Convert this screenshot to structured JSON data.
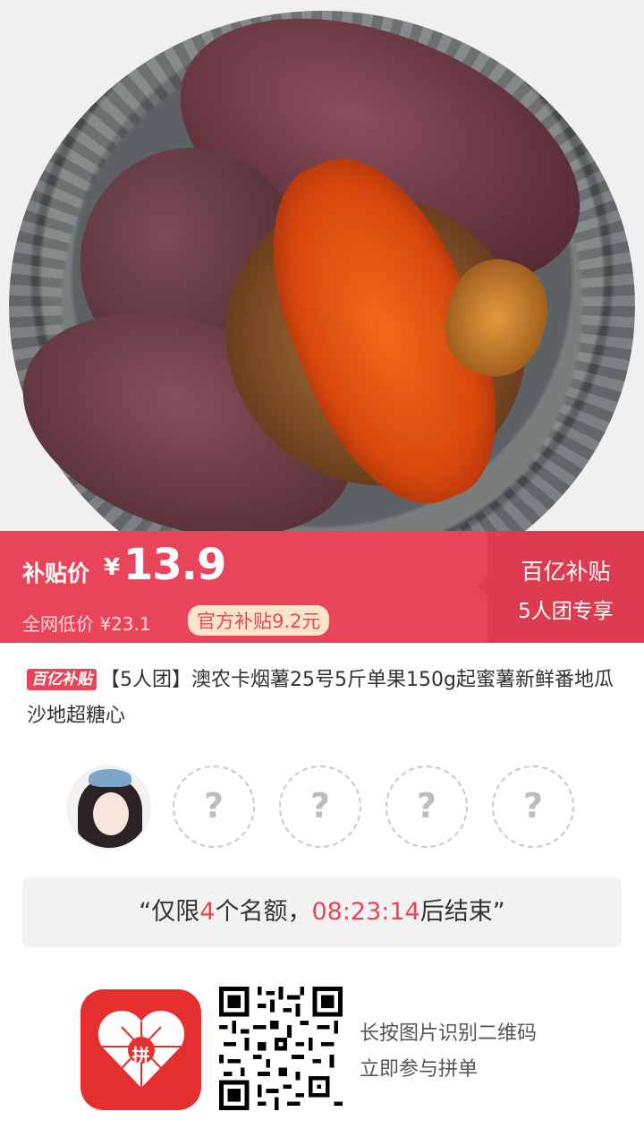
{
  "price": {
    "subsidy_label": "补贴价",
    "currency": "¥",
    "value": "13.9",
    "low_price_label": "全网低价",
    "low_price_value": "¥23.1",
    "subsidy_pill": "官方补贴9.2元",
    "right_title": "百亿补贴",
    "right_subtitle": "5人团专享"
  },
  "product": {
    "badge": "百亿补贴",
    "title": "【5人团】澳农卡烟薯25号5斤单果150g起蜜薯新鲜番地瓜沙地超糖心"
  },
  "group": {
    "slot_placeholder": "?",
    "empty_slots": 4
  },
  "notice": {
    "open_quote": "“",
    "prefix": "仅限",
    "count": "4",
    "middle": "个名额，",
    "time": "08:23:14",
    "suffix": "后结束",
    "close_quote": "”"
  },
  "footer": {
    "logo_text": "拼",
    "tip_line1": "长按图片识别二维码",
    "tip_line2": "立即参与拼单"
  },
  "colors": {
    "accent": "#e8455a",
    "accent_dark": "#dd3b50",
    "pill_bg": "#ffe5c8",
    "logo_red": "#e52e2e"
  }
}
